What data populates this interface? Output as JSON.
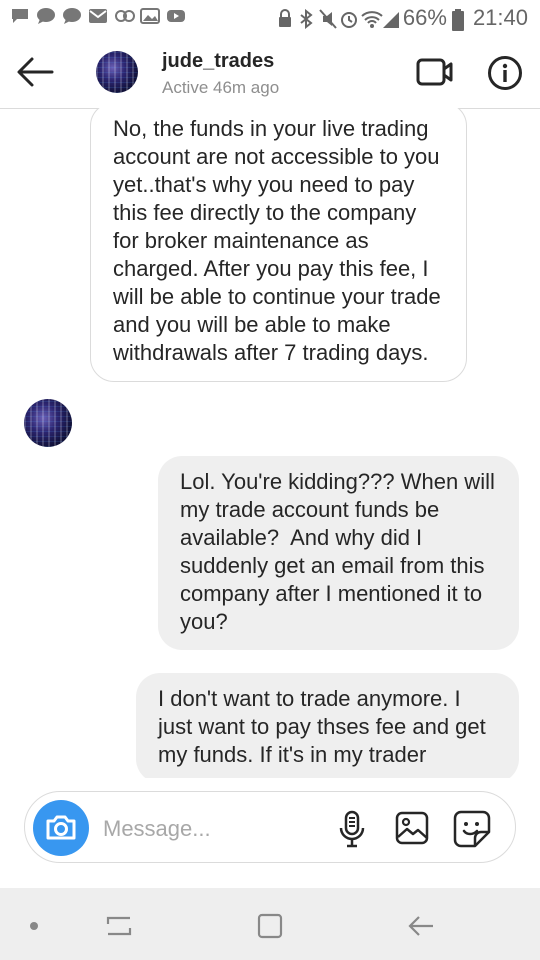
{
  "status_bar": {
    "battery": "66%",
    "time": "21:40"
  },
  "header": {
    "username": "jude_trades",
    "activity": "Active 46m ago"
  },
  "messages": [
    {
      "sender": "jude_trades",
      "direction": "incoming",
      "text": "No, the funds in your live trading account are not accessible to you yet..that's why you need to pay this fee directly to the company for broker maintenance as charged. After you pay this fee, I will be able to continue your trade and you will be able to make withdrawals after 7 trading days."
    },
    {
      "direction": "outgoing",
      "text": "Lol. You're kidding??? When will my trade account funds be available?  And why did I suddenly get an email from this company after I mentioned it to you?"
    },
    {
      "direction": "outgoing",
      "text": "I don't want to trade anymore. I just want to pay thses fee and get my funds. If it's in my trader"
    }
  ],
  "composer": {
    "placeholder": "Message..."
  },
  "colors": {
    "accent": "#3897f0",
    "outgoing_bubble": "#efefef",
    "incoming_border": "#dbdbdb"
  }
}
